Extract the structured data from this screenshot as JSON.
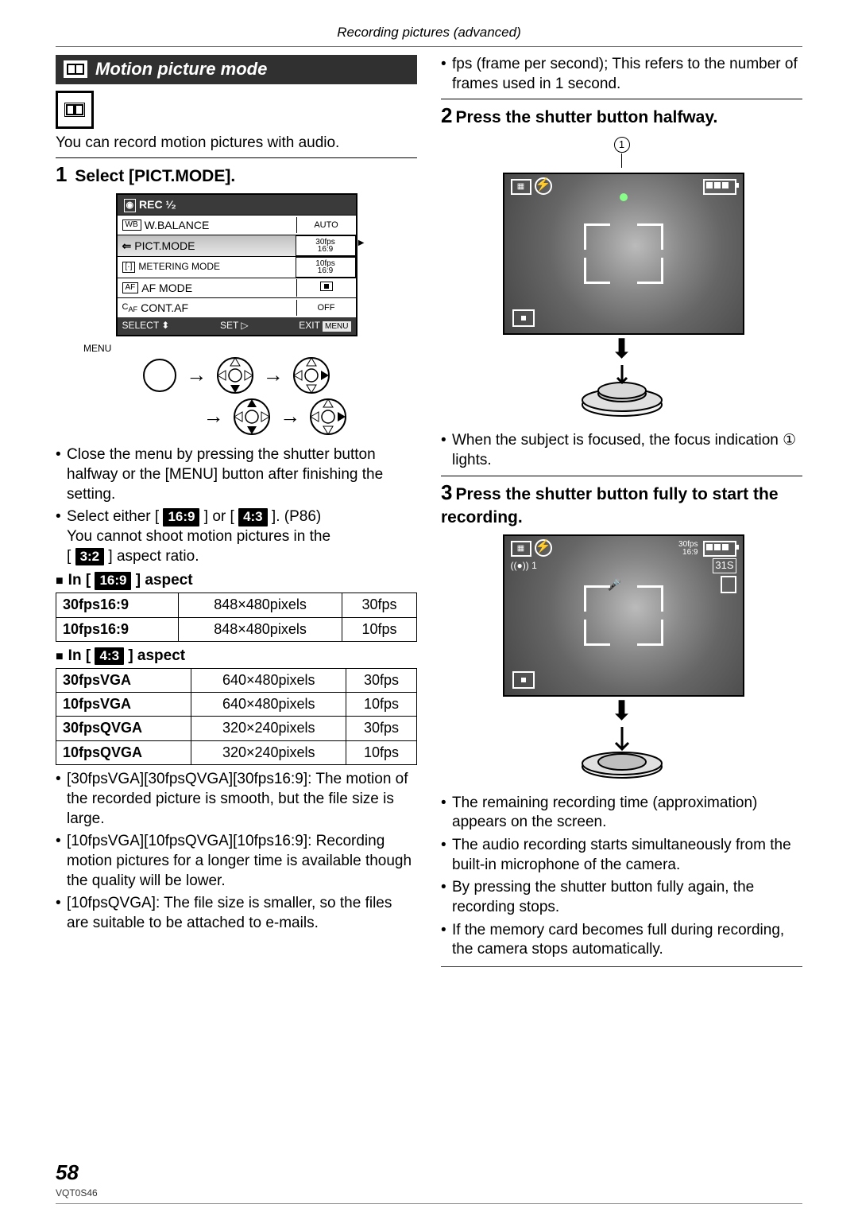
{
  "header": "Recording pictures (advanced)",
  "banner_title": "Motion picture mode",
  "intro": "You can record motion pictures with audio.",
  "step1_title": "Select [PICT.MODE].",
  "cam_menu": {
    "header": "REC  ¹⁄₂",
    "rows": [
      {
        "icon": "WB",
        "label": "W.BALANCE",
        "value": "AUTO"
      },
      {
        "icon": "←",
        "label": "PICT.MODE",
        "value": "30fps\n16:9",
        "sel": true
      },
      {
        "icon": "[·]",
        "label": "METERING MODE",
        "value": "10fps\n16:9"
      },
      {
        "icon": "AF",
        "label": "AF MODE",
        "value": "[■]"
      },
      {
        "icon": "C-AF",
        "label": "CONT.AF",
        "value": "OFF"
      }
    ],
    "footer_select": "SELECT",
    "footer_set": "SET",
    "footer_exit": "EXIT",
    "footer_menu": "MENU"
  },
  "nav_menu_label": "MENU",
  "left_bullets_a": [
    "Close the menu by pressing the shutter button halfway or the [MENU] button after finishing the setting."
  ],
  "ratio_sentence": {
    "pre": "Select either [",
    "mid": "] or [",
    "post": "]. (P86)",
    "line2_pre": "You cannot shoot motion pictures in the",
    "line3_pre": "[",
    "line3_post": "] aspect ratio."
  },
  "ratio_16_9": "16:9",
  "ratio_4_3": "4:3",
  "ratio_3_2": "3:2",
  "subhead_16_9_pre": "In [",
  "subhead_16_9_post": "] aspect",
  "tbl169": [
    [
      "30fps16:9",
      "848×480pixels",
      "30fps"
    ],
    [
      "10fps16:9",
      "848×480pixels",
      "10fps"
    ]
  ],
  "subhead_4_3_pre": "In [",
  "subhead_4_3_post": "] aspect",
  "tbl43": [
    [
      "30fpsVGA",
      "640×480pixels",
      "30fps"
    ],
    [
      "10fpsVGA",
      "640×480pixels",
      "10fps"
    ],
    [
      "30fpsQVGA",
      "320×240pixels",
      "30fps"
    ],
    [
      "10fpsQVGA",
      "320×240pixels",
      "10fps"
    ]
  ],
  "left_bullets_b": [
    "[30fpsVGA][30fpsQVGA][30fps16:9]: The motion of the recorded picture is smooth, but the file size is large.",
    "[10fpsVGA][10fpsQVGA][10fps16:9]: Recording motion pictures for a longer time is available though the quality will be lower.",
    "[10fpsQVGA]: The file size is smaller, so the files are suitable to be attached to e-mails."
  ],
  "right_bullets_top": [
    "fps (frame per second); This refers to the number of frames used in 1 second."
  ],
  "step2_title": "Press the shutter button halfway.",
  "callout_num": "1",
  "right_bullets_mid": [
    "When the subject is focused, the focus indication ① lights."
  ],
  "step3_title": "Press the shutter button fully to start the recording.",
  "lcd2": {
    "fps": "30fps",
    "aspect": "16:9",
    "rec": "((●)) 1",
    "timer": "31S"
  },
  "right_bullets_bot": [
    "The remaining recording time (approximation) appears on the screen.",
    "The audio recording starts simultaneously from the built-in microphone of the camera.",
    "By pressing the shutter button fully again, the recording stops.",
    "If the memory card becomes full during recording, the camera stops automatically."
  ],
  "page_number": "58",
  "doc_code": "VQT0S46"
}
